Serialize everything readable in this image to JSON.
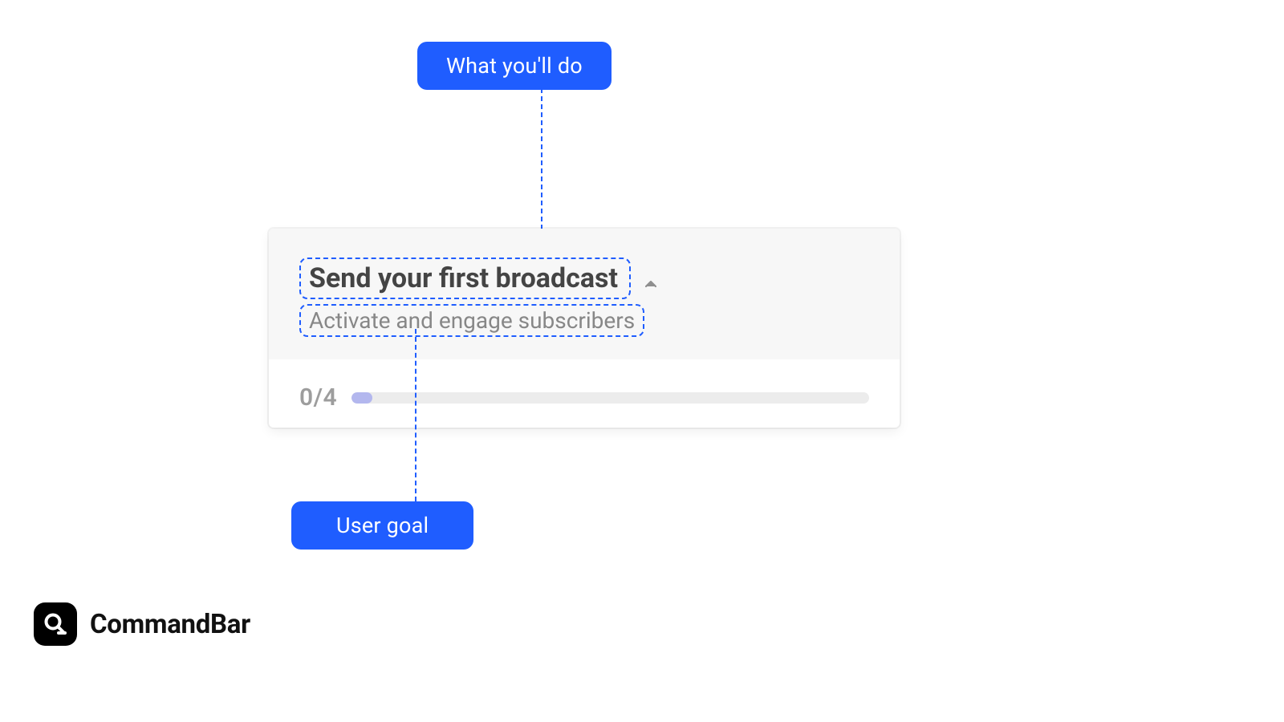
{
  "annotations": {
    "top": "What you'll do",
    "bottom": "User goal"
  },
  "card": {
    "title": "Send your first broadcast",
    "subtitle": "Activate and engage subscribers",
    "counter": "0/4"
  },
  "brand": {
    "name": "CommandBar"
  },
  "colors": {
    "accent": "#1f5dff",
    "progressFill": "#b3b7ee",
    "muted": "#9d9d9d"
  }
}
